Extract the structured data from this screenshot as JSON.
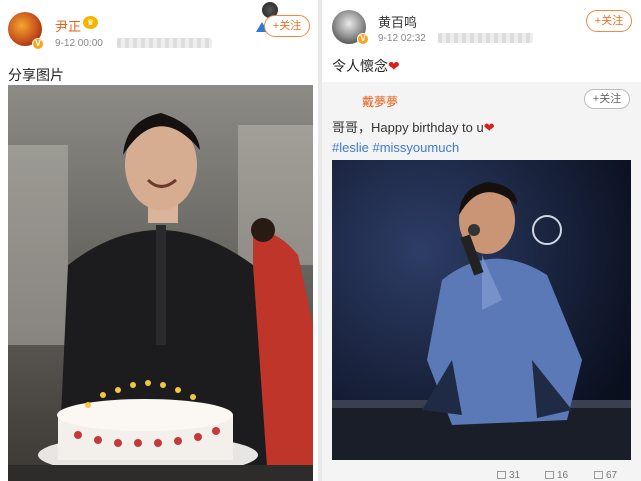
{
  "left_post": {
    "username": "尹正",
    "timestamp": "9-12 00:00",
    "follow_label": "+关注",
    "text": "分享图片",
    "verified_badge": "V",
    "image_icon": "birthday-cake-photo"
  },
  "right_post": {
    "username": "黄百鸣",
    "timestamp": "9-12 02:32",
    "follow_label": "+关注",
    "text": "令人懷念",
    "heart": "❤",
    "verified_badge": "V",
    "repost": {
      "username": "戴夢夢",
      "follow_label": "+关注",
      "text_line1": "哥哥，Happy birthday to u",
      "heart": "❤",
      "hashtag1": "#leslie",
      "hashtag2": "#missyoumuch",
      "image_icon": "singer-stage-photo"
    },
    "footer": {
      "reposts": "31",
      "comments": "16",
      "likes": "67"
    }
  },
  "colors": {
    "accent": "#f07020",
    "username": "#e8601c",
    "hashtag": "#3c7bd4",
    "heart": "#d81e1e"
  }
}
